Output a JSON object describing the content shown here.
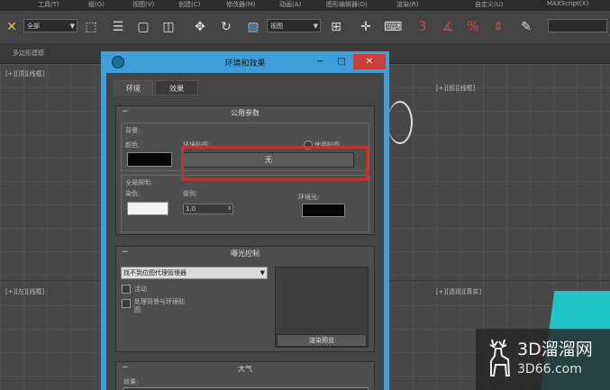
{
  "menubar": {
    "items": [
      "工具(T)",
      "组(G)",
      "视图(V)",
      "创建(C)",
      "修改器(M)",
      "动画(A)",
      "图形编辑器(D)",
      "渲染(R)",
      "自定义(U)",
      "MAXScript(X)"
    ]
  },
  "toolbar": {
    "selection_filter": "全部",
    "ref_coord": "视图"
  },
  "ribbon": {
    "label": "多边形建模"
  },
  "viewports": {
    "top_left": "[+][顶][线框]",
    "top_right": "[+][前][线框]",
    "bottom_left": "[+][左][线框]",
    "bottom_right": "[+][透视][真实]"
  },
  "dialog": {
    "title": "环境和效果",
    "minimize": "−",
    "maximize": "□",
    "close": "✕",
    "tabs": [
      "环境",
      "效果"
    ],
    "common_params": {
      "title": "公用参数",
      "background_label": "背景:",
      "color_label": "颜色:",
      "env_map_label": "环境贴图:",
      "use_map_label": "使用贴图",
      "map_button": "无",
      "global_lighting_label": "全局照明:",
      "tint_label": "染色:",
      "level_label": "级别:",
      "level_value": "1.0",
      "ambient_label": "环境光:"
    },
    "exposure": {
      "title": "曝光控制",
      "dropdown_value": "找不到位图代理管理器",
      "active_label": "活动",
      "process_bg_label": "处理背景与环境贴图",
      "render_preview_button": "渲染预览"
    },
    "atmosphere": {
      "title": "大气",
      "effects_label": "效果:"
    }
  },
  "watermark": {
    "text": "3D溜溜网",
    "sub": "3D66.com"
  },
  "colors": {
    "dialog_frame": "#3f9ed9",
    "highlight": "#c33232",
    "accent_teal": "#21c5c8"
  }
}
